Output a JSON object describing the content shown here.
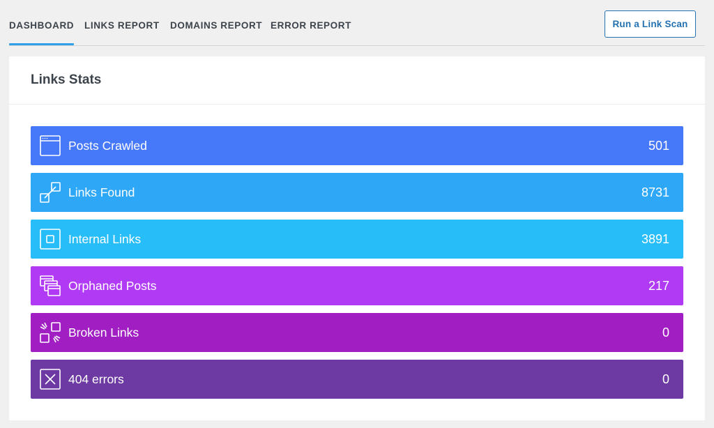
{
  "nav": {
    "tabs": [
      {
        "label": "DASHBOARD",
        "active": true
      },
      {
        "label": "LINKS REPORT",
        "active": false
      },
      {
        "label": "DOMAINS REPORT",
        "active": false
      },
      {
        "label": "ERROR REPORT",
        "active": false
      }
    ],
    "scan_button": "Run a Link Scan"
  },
  "panel": {
    "title": "Links Stats",
    "stats": [
      {
        "label": "Posts Crawled",
        "value": "501",
        "icon": "browser-window-icon",
        "color": "#4678fa"
      },
      {
        "label": "Links Found",
        "value": "8731",
        "icon": "link-squares-icon",
        "color": "#2ea8f6"
      },
      {
        "label": "Internal Links",
        "value": "3891",
        "icon": "internal-square-icon",
        "color": "#27bdf8"
      },
      {
        "label": "Orphaned Posts",
        "value": "217",
        "icon": "stacked-windows-icon",
        "color": "#b13af5"
      },
      {
        "label": "Broken Links",
        "value": "0",
        "icon": "broken-link-icon",
        "color": "#a11fc2"
      },
      {
        "label": "404 errors",
        "value": "0",
        "icon": "x-box-icon",
        "color": "#6d3aa3"
      }
    ]
  },
  "colors": {
    "accent": "#2f9fe8",
    "button": "#2271b1",
    "background": "#f0f0f1"
  }
}
